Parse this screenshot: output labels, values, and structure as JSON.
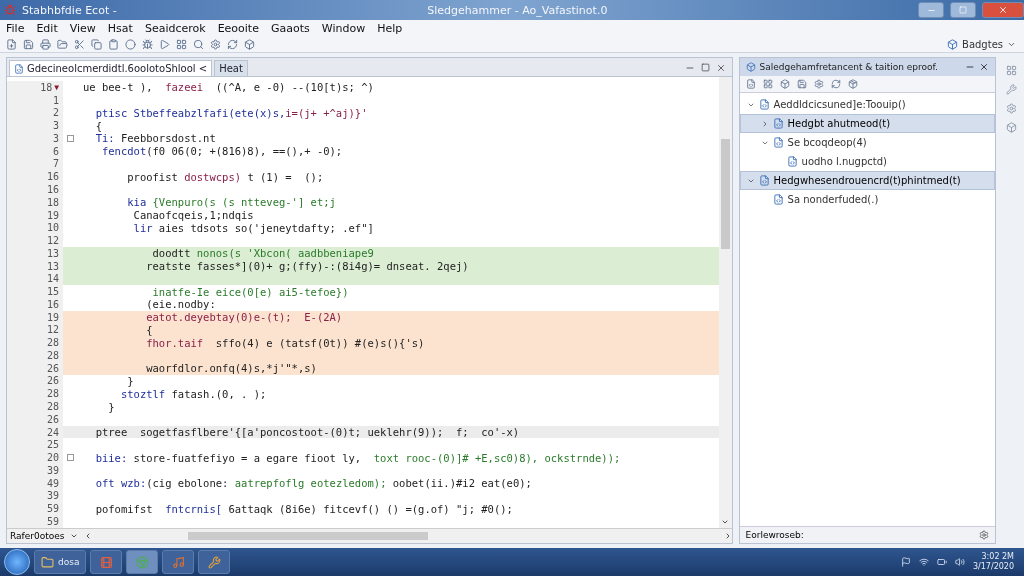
{
  "window": {
    "app_title": "Stabhbfdie Ecot -",
    "title": "Sledgehammer - Ao_Vafastinot.0"
  },
  "menu": [
    "File",
    "Edit",
    "View",
    "Hsat",
    "Seaidcerok",
    "Eeooite",
    "Gaaots",
    "Window",
    "Help"
  ],
  "toolbar": {
    "perspective": "Badgtes"
  },
  "editor": {
    "tabs": [
      {
        "label": "Gdecineolcmerdidtl.6oolotoShlool <",
        "selected": true
      },
      {
        "label": "Heat",
        "selected": false
      }
    ],
    "lines": [
      {
        "number": "18",
        "kind": "plain",
        "marker": "▼",
        "segments": [
          {
            "text": "ue bee-t ),  ",
            "kind": "plain"
          },
          {
            "text": "fazeei",
            "kind": "purple"
          },
          {
            "text": "  ((^A, e -0) --(10[t)s; ^)",
            "kind": "plain"
          }
        ]
      },
      {
        "number": "1",
        "kind": "plain"
      },
      {
        "number": "2",
        "kind": "plain",
        "segments": [
          {
            "text": "  ptisc Stbeffeabzlfafi(ete(x)s,",
            "kind": "keyword"
          },
          {
            "text": "i=(j+ +^aj)}'",
            "kind": "purple"
          }
        ]
      },
      {
        "number": "3",
        "kind": "plain",
        "segments": [
          {
            "text": "  {",
            "kind": "plain"
          }
        ]
      },
      {
        "number": "3",
        "kind": "plain",
        "fold": true,
        "segments": [
          {
            "text": "  Ti: ",
            "kind": "keyword"
          },
          {
            "text": "Feebborsdost.nt",
            "kind": "plain"
          }
        ]
      },
      {
        "number": "6",
        "kind": "plain",
        "segments": [
          {
            "text": "   fencdot",
            "kind": "keyword"
          },
          {
            "text": "(f0 06(0; +(816)8), ==(),+ -0);",
            "kind": "plain"
          }
        ]
      },
      {
        "number": "7",
        "kind": "plain"
      },
      {
        "number": "16",
        "kind": "plain",
        "segments": [
          {
            "text": "       proofist ",
            "kind": "plain"
          },
          {
            "text": "dostwcps)",
            "kind": "purple"
          },
          {
            "text": " t (1) =  ();",
            "kind": "plain"
          }
        ]
      },
      {
        "number": "16",
        "kind": "plain"
      },
      {
        "number": "18",
        "kind": "plain",
        "segments": [
          {
            "text": "       kia ",
            "kind": "keyword"
          },
          {
            "text": "{Venpuro(s (s ntteveg-'] et;j",
            "kind": "string"
          }
        ]
      },
      {
        "number": "19",
        "kind": "plain",
        "segments": [
          {
            "text": "        Canaofcqeis,1;ndqis",
            "kind": "plain"
          }
        ]
      },
      {
        "number": "10",
        "kind": "plain",
        "segments": [
          {
            "text": "        lir ",
            "kind": "keyword"
          },
          {
            "text": "aies tdsots so('jeneytdafty; .ef\"]",
            "kind": "plain"
          }
        ]
      },
      {
        "number": "12",
        "kind": "plain"
      },
      {
        "number": "13",
        "kind": "green",
        "segments": [
          {
            "text": "           doodtt ",
            "kind": "plain"
          },
          {
            "text": "nonos(s 'Xbcon( aadbbeniape9",
            "kind": "string"
          }
        ]
      },
      {
        "number": "13",
        "kind": "green",
        "segments": [
          {
            "text": "          reatste fasses*](0)+ g;(ffy)-:(8i4g)= dnseat. 2qej)",
            "kind": "plain"
          }
        ]
      },
      {
        "number": "14",
        "kind": "green"
      },
      {
        "number": "15",
        "kind": "plain",
        "segments": [
          {
            "text": "           inatfe-Ie eice(0[e) ai5-tefoe})",
            "kind": "string"
          }
        ]
      },
      {
        "number": "16",
        "kind": "plain",
        "segments": [
          {
            "text": "          (eie.nodby:",
            "kind": "plain"
          }
        ]
      },
      {
        "number": "19",
        "kind": "orange",
        "segments": [
          {
            "text": "          eatot.deyebtay(0)e-(t);  E-(2A)",
            "kind": "purple"
          }
        ]
      },
      {
        "number": "12",
        "kind": "orange",
        "segments": [
          {
            "text": "          {",
            "kind": "plain"
          }
        ]
      },
      {
        "number": "28",
        "kind": "orange",
        "segments": [
          {
            "text": "          fhor.taif  ",
            "kind": "purple"
          },
          {
            "text": "sffo(4) e (tatsf(0t)) #(e)s(){'s)",
            "kind": "plain"
          }
        ]
      },
      {
        "number": "28",
        "kind": "orange"
      },
      {
        "number": "26",
        "kind": "orange",
        "segments": [
          {
            "text": "          waorfdlor.onfq(4)s,*j'\"*,s)",
            "kind": "plain"
          }
        ]
      },
      {
        "number": "26",
        "kind": "plain",
        "segments": [
          {
            "text": "       }",
            "kind": "plain"
          }
        ]
      },
      {
        "number": "28",
        "kind": "plain",
        "segments": [
          {
            "text": "      stoztlf ",
            "kind": "keyword"
          },
          {
            "text": "fatash.(0, . );",
            "kind": "plain"
          }
        ]
      },
      {
        "number": "28",
        "kind": "plain",
        "segments": [
          {
            "text": "    }",
            "kind": "plain"
          }
        ]
      },
      {
        "number": "26",
        "kind": "plain"
      },
      {
        "number": "24",
        "kind": "current",
        "segments": [
          {
            "text": "  ptree  sogetfasflbere'{[a'poncostoot-(0)t; ueklehr(9));  f;  co'-x)",
            "kind": "plain"
          }
        ]
      },
      {
        "number": "25",
        "kind": "plain"
      },
      {
        "number": "20",
        "kind": "plain",
        "fold": true,
        "segments": [
          {
            "text": "  biie: ",
            "kind": "keyword"
          },
          {
            "text": "store-fuatfefiyo = a egare fioot ly,  ",
            "kind": "plain"
          },
          {
            "text": "toxt rooc-(0)]# +E,sc0)8), ockstrnde));",
            "kind": "string"
          }
        ]
      },
      {
        "number": "39",
        "kind": "plain"
      },
      {
        "number": "49",
        "kind": "plain",
        "segments": [
          {
            "text": "  oft wzb:",
            "kind": "keyword"
          },
          {
            "text": "(cig ebolone: ",
            "kind": "plain"
          },
          {
            "text": "aatrepfoflg eotezledom);",
            "kind": "string"
          },
          {
            "text": " oobet(ii.)#i2 eat(e0);",
            "kind": "plain"
          }
        ]
      },
      {
        "number": "39",
        "kind": "plain"
      },
      {
        "number": "59",
        "kind": "plain",
        "segments": [
          {
            "text": "  pofomifst  ",
            "kind": "plain"
          },
          {
            "text": "fntcrnis[",
            "kind": "keyword"
          },
          {
            "text": " 6attaqk (8i6e) fitcevf() () =(g.of) \"j; #0();",
            "kind": "plain"
          }
        ]
      },
      {
        "number": "59",
        "kind": "plain"
      }
    ],
    "bottom_label": "Rafer0otoes"
  },
  "outline": {
    "title": "Saledgehamfretancent & taition eproof.",
    "tree": [
      {
        "label": "Aeddldcicsuned]e:Toouip()",
        "expanded": true,
        "selected": false,
        "children": [
          {
            "label": "Hedgbt ahutmeod(t)",
            "expanded": false,
            "selected": true
          },
          {
            "label": "Se bcoqdeop(4)",
            "expanded": true,
            "selected": false,
            "children": [
              {
                "label": "uodho l.nugpctd)",
                "selected": false
              }
            ]
          }
        ]
      },
      {
        "label": "Hedgwhesendrouencrd(t)phintmed(t)",
        "expanded": true,
        "selected": true,
        "children": [
          {
            "label": "Sa nonderfuded(.)",
            "selected": false
          }
        ]
      }
    ],
    "status": "Eorlewroseb:"
  },
  "taskbar": {
    "items": [
      {
        "kind": "folder",
        "label": "dosa"
      },
      {
        "kind": "media"
      },
      {
        "kind": "browser",
        "selected": true
      },
      {
        "kind": "player"
      },
      {
        "kind": "tool"
      }
    ],
    "clock_time": "3:02 2M",
    "clock_date": "3/17/2020"
  }
}
